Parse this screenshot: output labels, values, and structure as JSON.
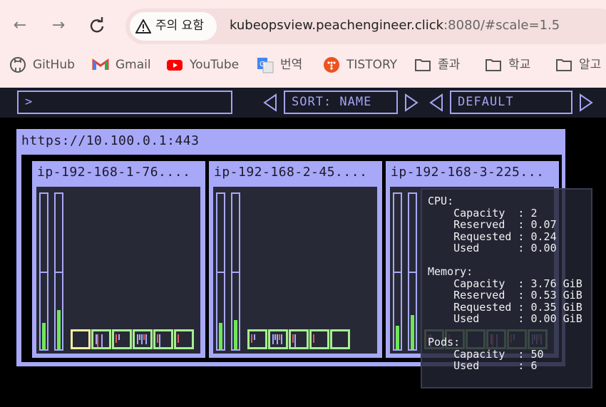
{
  "browser": {
    "security_label": "주의 요함",
    "url_host": "kubeopsview.peachengineer.click",
    "url_rest": ":8080/#scale=1.5",
    "bookmarks": [
      {
        "label": "GitHub",
        "icon": "github-icon"
      },
      {
        "label": "Gmail",
        "icon": "gmail-icon"
      },
      {
        "label": "YouTube",
        "icon": "youtube-icon"
      },
      {
        "label": "번역",
        "icon": "google-translate-icon"
      },
      {
        "label": "TISTORY",
        "icon": "tistory-icon"
      },
      {
        "label": "졸과",
        "icon": "folder-icon"
      },
      {
        "label": "학교",
        "icon": "folder-icon"
      },
      {
        "label": "알고",
        "icon": "folder-icon"
      }
    ]
  },
  "toolbar": {
    "filter_value": ">",
    "sort_label": "SORT: NAME",
    "theme_label": "DEFAULT"
  },
  "cluster": {
    "url": "https://10.100.0.1:443",
    "nodes": [
      {
        "name": "ip-192-168-1-76....",
        "cpu_level": 0.17,
        "mem_level": 0.25,
        "pods": 6,
        "pending_pods": 1
      },
      {
        "name": "ip-192-168-2-45....",
        "cpu_level": 0.17,
        "mem_level": 0.19,
        "pods": 5,
        "pending_pods": 0
      },
      {
        "name": "ip-192-168-3-225...",
        "cpu_level": 0.15,
        "mem_level": 0.22,
        "pods": 6,
        "pending_pods": 0
      }
    ]
  },
  "tooltip": {
    "cpu_header": "CPU:",
    "cpu_lines": [
      "    Capacity  : 2",
      "    Reserved  : 0.07",
      "    Requested : 0.24",
      "    Used      : 0.00"
    ],
    "memory_header": "Memory:",
    "memory_lines": [
      "    Capacity  : 3.76 GiB",
      "    Reserved  : 0.53 GiB",
      "    Requested : 0.35 GiB",
      "    Used      : 0.00 GiB"
    ],
    "pods_header": "Pods:",
    "pods_lines": [
      "    Capacity  : 50",
      "    Used      : 6"
    ]
  },
  "colors": {
    "accent": "#a8a8f8",
    "pod_running": "#a6ef8f",
    "pod_pending": "#f3f0a0",
    "usage_fill": "#6ee65a"
  }
}
